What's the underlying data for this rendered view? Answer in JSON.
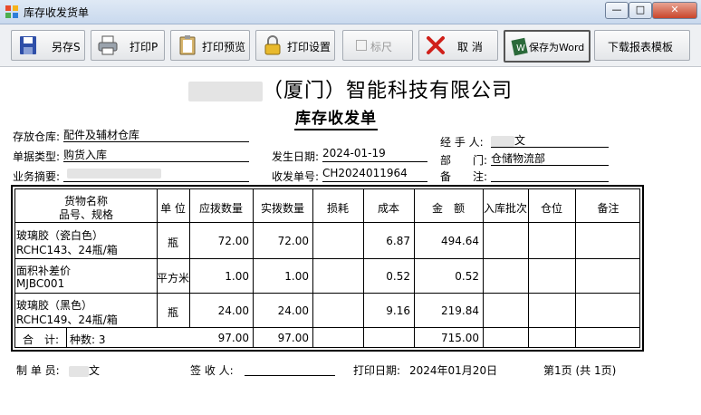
{
  "window": {
    "title": "库存收发货单"
  },
  "toolbar": {
    "save_as": "另存S",
    "print": "打印P",
    "print_preview": "打印预览",
    "print_settings": "打印设置",
    "ruler": "标尺",
    "cancel": "取 消",
    "save_word": "保存为Word",
    "download_template": "下载报表模板"
  },
  "doc": {
    "company_visible": "（厦门）智能科技有限公司",
    "title": "库存收发单",
    "warehouse_label": "存放仓库:",
    "warehouse_value": "配件及辅材仓库",
    "doc_type_label": "单据类型:",
    "doc_type_value": "购货入库",
    "summary_label": "业务摘要:",
    "date_label": "发生日期:",
    "date_value": "2024-01-19",
    "number_label": "收发单号:",
    "number_value": "CH2024011964",
    "handler_label": "经 手 人:",
    "handler_value": "文",
    "dept_label_a": "部",
    "dept_label_b": "门:",
    "dept_value": "仓储物流部",
    "remark_label_a": "备",
    "remark_label_b": "注:"
  },
  "table": {
    "headers": {
      "name_line1": "货物名称",
      "name_line2": "品号、规格",
      "unit": "单 位",
      "due_qty": "应拨数量",
      "actual_qty": "实拨数量",
      "loss": "损耗",
      "cost": "成本",
      "amount": "金　额",
      "batch": "入库批次",
      "location": "仓位",
      "remark": "备注"
    },
    "rows": [
      {
        "name": "玻璃胶（瓷白色）",
        "spec": "RCHC143、24瓶/箱",
        "unit": "瓶",
        "due": "72.00",
        "actual": "72.00",
        "loss": "",
        "cost": "6.87",
        "amount": "494.64"
      },
      {
        "name": "面积补差价",
        "spec": "MJBC001",
        "unit": "平方米",
        "due": "1.00",
        "actual": "1.00",
        "loss": "",
        "cost": "0.52",
        "amount": "0.52"
      },
      {
        "name": "玻璃胶（黑色）",
        "spec": "RCHC149、24瓶/箱",
        "unit": "瓶",
        "due": "24.00",
        "actual": "24.00",
        "loss": "",
        "cost": "9.16",
        "amount": "219.84"
      }
    ],
    "total": {
      "label": "合　计:",
      "kinds": "种数: 3",
      "due": "97.00",
      "actual": "97.00",
      "amount": "715.00"
    }
  },
  "footer": {
    "maker_label": "制 单 员:",
    "maker_value": "文",
    "receiver_label": "签 收 人:",
    "print_date_label": "打印日期:",
    "print_date_value": "2024年01月20日",
    "page": "第1页 (共 1页)"
  }
}
